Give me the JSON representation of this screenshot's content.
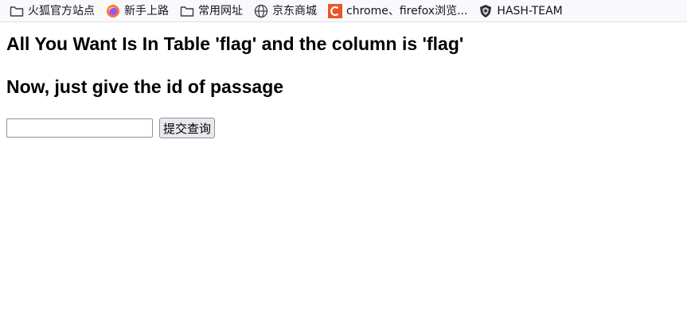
{
  "bookmarks": [
    {
      "label": "火狐官方站点",
      "icon": "folder-icon"
    },
    {
      "label": "新手上路",
      "icon": "firefox-icon"
    },
    {
      "label": "常用网址",
      "icon": "folder-icon"
    },
    {
      "label": "京东商城",
      "icon": "globe-icon"
    },
    {
      "label": "chrome、firefox浏览...",
      "icon": "c-logo-icon"
    },
    {
      "label": "HASH-TEAM",
      "icon": "shield-logo-icon"
    }
  ],
  "page": {
    "heading1": "All You Want Is In Table 'flag' and the column is 'flag'",
    "heading2": "Now, just give the id of passage",
    "input_value": "",
    "submit_label": "提交查询"
  }
}
